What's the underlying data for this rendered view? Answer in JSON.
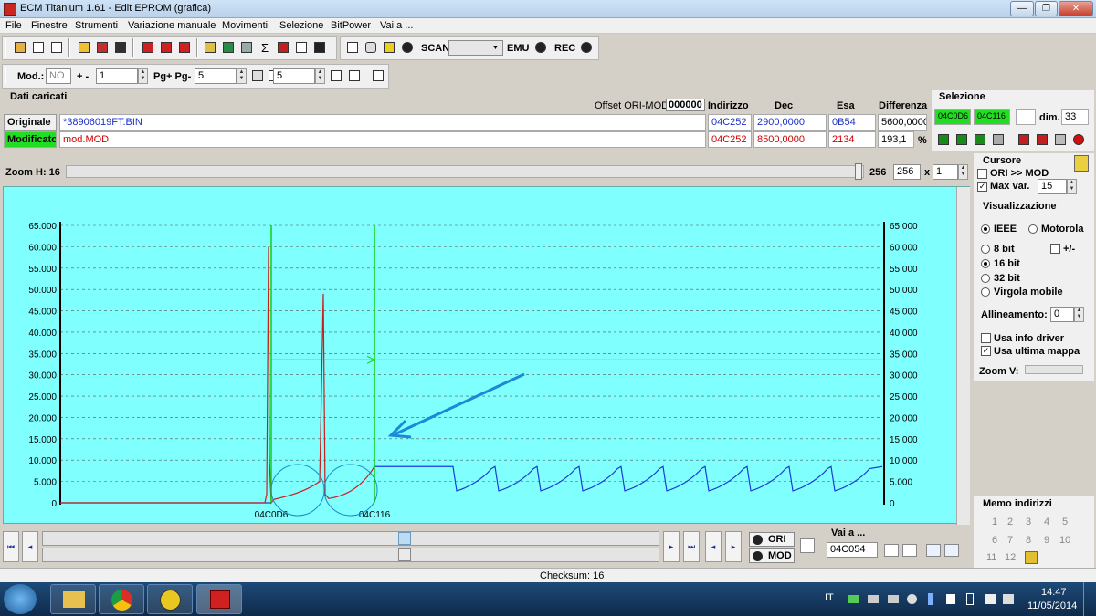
{
  "window": {
    "title": "ECM Titanium 1.61 - Edit EPROM (grafica)",
    "min": "—",
    "max": "❐",
    "close": "✕"
  },
  "menu": [
    "File",
    "Finestre",
    "Strumenti",
    "Variazione manuale",
    "Movimenti",
    "Selezione",
    "BitPower",
    "Vai a ..."
  ],
  "toolbar1": {
    "scan": "SCAN",
    "emu": "EMU",
    "rec": "REC",
    "scan_select": ""
  },
  "toolbar2": {
    "mod_label": "Mod.:",
    "mod_value": "NO",
    "plusminus": "+ -",
    "step_value": "1",
    "pg_label": "Pg+ Pg-",
    "pg_value": "5",
    "p_value": "5"
  },
  "dati": {
    "title": "Dati caricati",
    "offset_label": "Offset ORI-MOD",
    "offset_value": "000000",
    "col_indirizzo": "Indirizzo",
    "col_dec": "Dec",
    "col_esa": "Esa",
    "col_diff": "Differenza",
    "ori_label": "Originale",
    "ori_file": "*38906019FT.BIN",
    "ori_addr": "04C252",
    "ori_dec": "2900,0000",
    "ori_esa": "0B54",
    "ori_diff": "5600,0000",
    "mod_label": "Modificato",
    "mod_file": "mod.MOD",
    "mod_addr": "04C252",
    "mod_dec": "8500,0000",
    "mod_esa": "2134",
    "mod_diff": "193,1",
    "mod_unit": "%"
  },
  "selezione": {
    "title": "Selezione",
    "start": "04C0D6",
    "end": "04C116",
    "blank": "",
    "dim_label": "dim.",
    "dim_value": "33"
  },
  "zoom": {
    "label": "Zoom H: 16",
    "value1": "256",
    "value2": "256",
    "times": "x",
    "mult": "1"
  },
  "cursore": {
    "title": "Cursore",
    "ori_mod": "ORI >> MOD",
    "maxvar_label": "Max var.",
    "maxvar_value": "15"
  },
  "visual": {
    "title": "Visualizzazione",
    "ieee": "IEEE",
    "motorola": "Motorola",
    "b8": "8 bit",
    "pm": "+/-",
    "b16": "16 bit",
    "b32": "32 bit",
    "virgola": "Virgola mobile",
    "allin_label": "Allineamento:",
    "allin_value": "0",
    "info_driver": "Usa info driver",
    "ultima_mappa": "Usa ultima mappa",
    "zoomv": "Zoom V:"
  },
  "memo": {
    "title": "Memo indirizzi",
    "items": [
      "1",
      "2",
      "3",
      "4",
      "5",
      "6",
      "7",
      "8",
      "9",
      "10",
      "11",
      "12"
    ]
  },
  "bottom": {
    "ori": "ORI",
    "mod": "MOD",
    "vai_label": "Vai a ...",
    "vai_value": "04C054",
    "checksum": "Checksum: 16"
  },
  "tray": {
    "lang": "IT",
    "time": "14:47",
    "date": "11/05/2014"
  },
  "chart_data": {
    "type": "line",
    "ylim": [
      0,
      65000
    ],
    "yticks": [
      "0",
      "5.000",
      "10.000",
      "15.000",
      "20.000",
      "25.000",
      "30.000",
      "35.000",
      "40.000",
      "45.000",
      "50.000",
      "55.000",
      "60.000",
      "65.000"
    ],
    "markers": [
      {
        "label": "04C0D6"
      },
      {
        "label": "04C116"
      }
    ],
    "colors": {
      "original": "#1a3cd6",
      "modified": "#c81e1e",
      "selection": "#10d010",
      "background": "#80ffff"
    }
  }
}
